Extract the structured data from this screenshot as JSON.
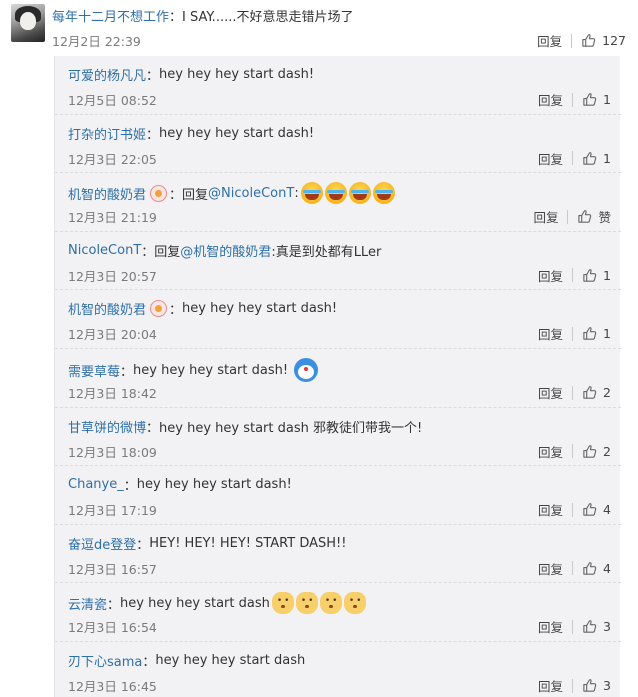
{
  "top_comment": {
    "author": "每年十二月不想工作",
    "text": "I SAY......不好意思走错片场了",
    "time": "12月2日 22:39",
    "reply_label": "回复",
    "likes": "127"
  },
  "replies": [
    {
      "author": "可爱的杨凡凡",
      "text": "hey hey hey start dash!",
      "time": "12月5日 08:52",
      "reply_label": "回复",
      "likes": "1"
    },
    {
      "author": "打杂的订书姬",
      "text": "hey hey hey start dash!",
      "time": "12月3日 22:05",
      "reply_label": "回复",
      "likes": "1"
    },
    {
      "author": "机智的酸奶君",
      "text": "回复",
      "mention": "@NicoleConT",
      "text_after": ":",
      "time": "12月3日 21:19",
      "reply_label": "回复",
      "likes": "赞"
    },
    {
      "author": "NicoleConT",
      "text": "回复",
      "mention": "@机智的酸奶君",
      "text_after": ":真是到处都有LLer",
      "time": "12月3日 20:57",
      "reply_label": "回复",
      "likes": "1"
    },
    {
      "author": "机智的酸奶君",
      "text": "hey hey hey start dash!",
      "time": "12月3日 20:04",
      "reply_label": "回复",
      "likes": "1"
    },
    {
      "author": "需要草莓",
      "text": "hey hey hey start dash!",
      "time": "12月3日 18:42",
      "reply_label": "回复",
      "likes": "2"
    },
    {
      "author": "甘草饼的微博",
      "text": "hey hey hey start dash  邪教徒们带我一个!",
      "time": "12月3日 18:09",
      "reply_label": "回复",
      "likes": "2"
    },
    {
      "author": "Chanye_",
      "text": "hey hey hey start dash!",
      "time": "12月3日 17:19",
      "reply_label": "回复",
      "likes": "4"
    },
    {
      "author": "奋逗de登登",
      "text": "HEY! HEY! HEY! START DASH!!",
      "time": "12月3日 16:57",
      "reply_label": "回复",
      "likes": "4"
    },
    {
      "author": "云清瓷",
      "text": "hey hey hey start dash",
      "time": "12月3日 16:54",
      "reply_label": "回复",
      "likes": "3"
    },
    {
      "author": "刃下心sama",
      "text": "hey hey hey start dash",
      "time": "12月3日 16:45",
      "reply_label": "回复",
      "likes": "3"
    }
  ],
  "separator": "：",
  "colors": {
    "link": "#2e6fa7",
    "panel_bg": "#f2f2f5",
    "time": "#7a7a7a"
  },
  "icons": {
    "like": "thumbs-up-icon",
    "laugh": "laughing-tears-emoji",
    "dog": "doge-emoji",
    "badge": "vip-badge-icon",
    "doraemon": "doraemon-emoji"
  }
}
